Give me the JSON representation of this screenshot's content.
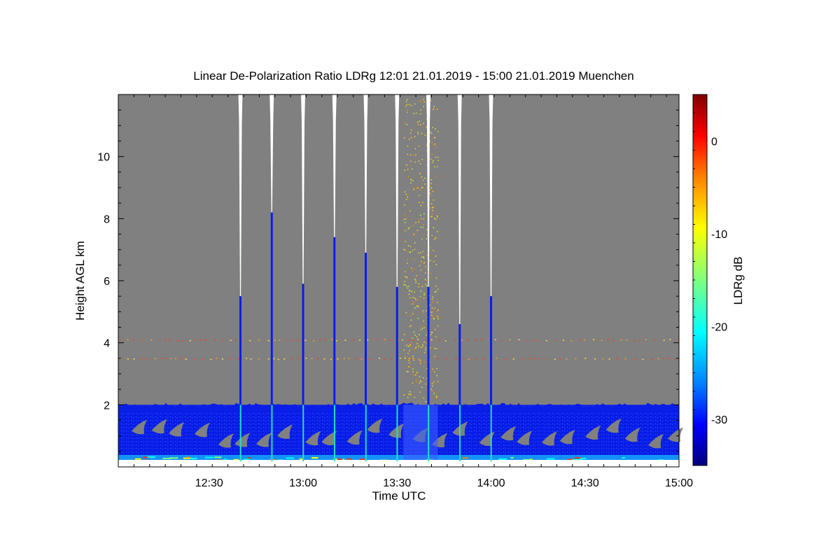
{
  "chart_data": {
    "type": "heatmap",
    "title": "Linear De-Polarization Ratio LDRg   12:01 21.01.2019 - 15:00 21.01.2019 Muenchen",
    "xlabel": "Time UTC",
    "ylabel": "Height AGL km",
    "colorbar_label": "LDRg dB",
    "x_range": [
      "12:01",
      "15:00"
    ],
    "x_ticks": [
      "12:30",
      "13:00",
      "13:30",
      "14:00",
      "14:30",
      "15:00"
    ],
    "y_range": [
      0,
      12
    ],
    "y_ticks": [
      "2",
      "4",
      "6",
      "8",
      "10"
    ],
    "colorbar_range": [
      -35,
      5
    ],
    "colorbar_ticks": [
      "0",
      "-10",
      "-20",
      "-30"
    ],
    "colormap": [
      "#00007f",
      "#0000ff",
      "#007fff",
      "#00ffff",
      "#7fff7f",
      "#ffff00",
      "#ff7f00",
      "#ff0000",
      "#7f0000"
    ],
    "background_color": "#808080",
    "low_layer": {
      "top_km": 2.0,
      "dominant_ldr_db": -30
    },
    "horizontal_bands_km": [
      3.5,
      4.1
    ],
    "fall_streaks": [
      {
        "time": "12:40",
        "top_km": 5.5
      },
      {
        "time": "12:50",
        "top_km": 8.2
      },
      {
        "time": "13:00",
        "top_km": 5.9
      },
      {
        "time": "13:10",
        "top_km": 7.4
      },
      {
        "time": "13:20",
        "top_km": 6.9
      },
      {
        "time": "13:30",
        "top_km": 5.8
      },
      {
        "time": "13:40",
        "top_km": 5.8
      },
      {
        "time": "13:50",
        "top_km": 4.6
      },
      {
        "time": "14:00",
        "top_km": 5.5
      }
    ],
    "scatter_column": {
      "start": "13:32",
      "end": "13:43",
      "dominant_ldr_db": -10
    }
  }
}
